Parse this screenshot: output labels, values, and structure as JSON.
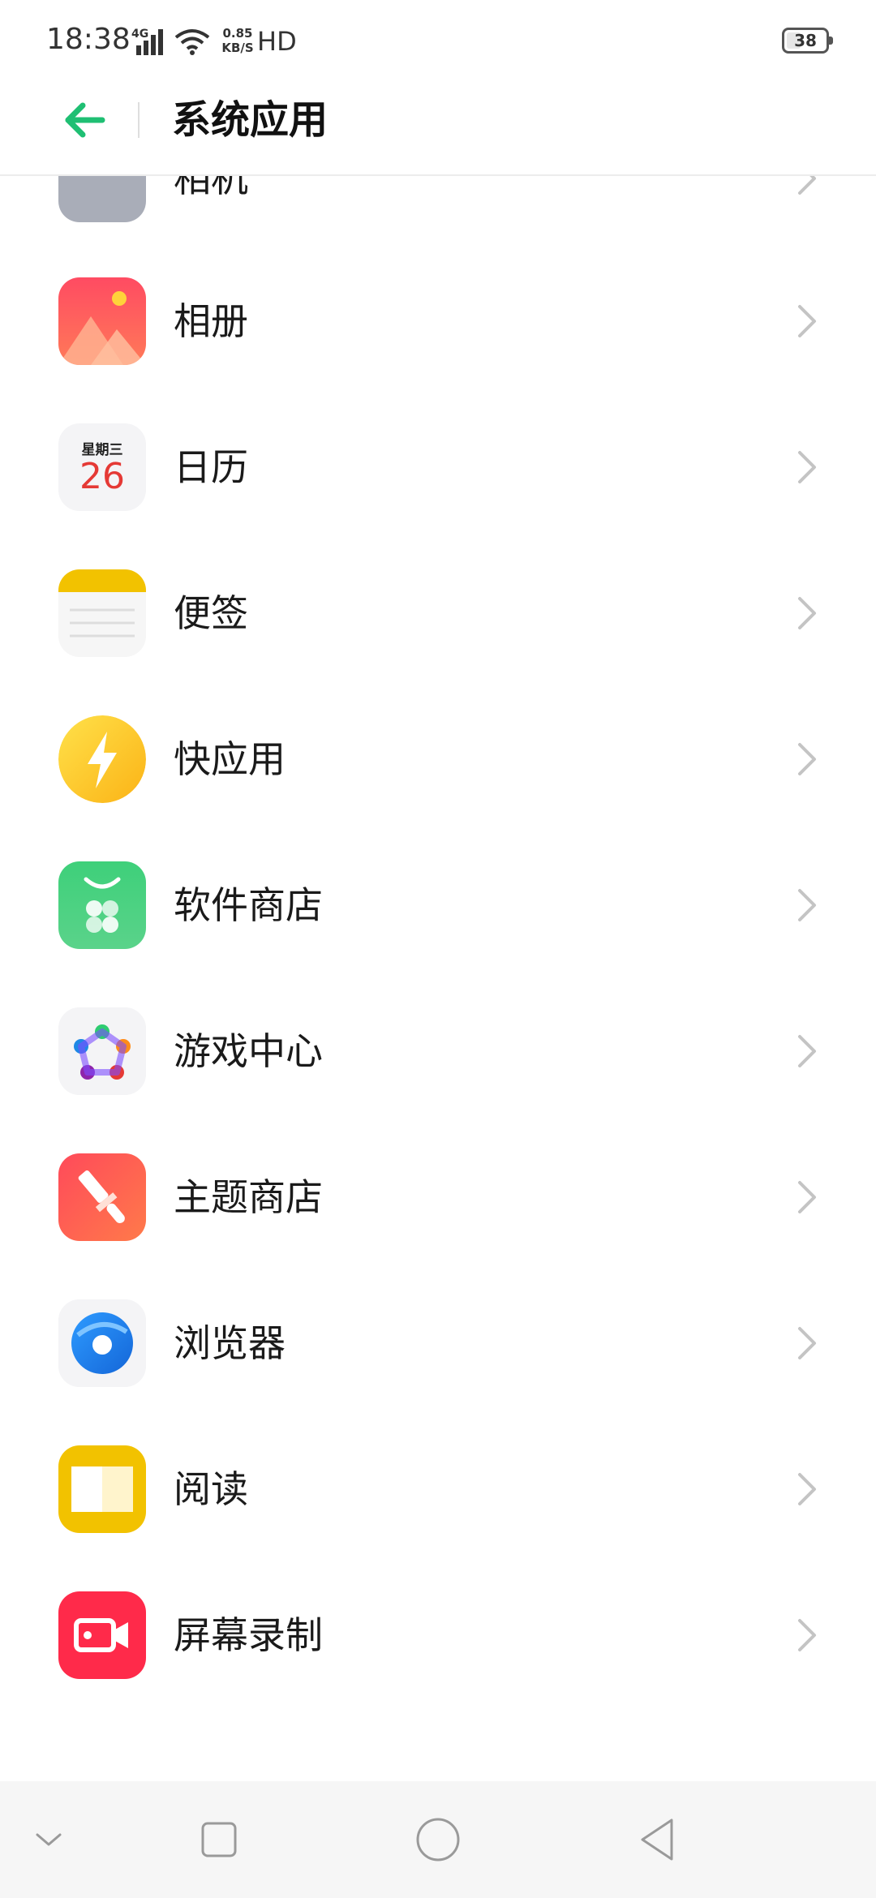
{
  "status": {
    "time": "18:38",
    "net_type": "4G",
    "speed_value": "0.85",
    "speed_unit": "KB/S",
    "hd": "HD",
    "battery": "38",
    "battery_level": 0.38
  },
  "header": {
    "title": "系统应用",
    "back_icon": "arrow-left-icon",
    "accent": "#1fbf73"
  },
  "apps": [
    {
      "label": "相机",
      "icon": "camera-app-icon"
    },
    {
      "label": "相册",
      "icon": "photos-app-icon"
    },
    {
      "label": "日历",
      "icon": "calendar-app-icon",
      "weekday": "星期三",
      "day": "26"
    },
    {
      "label": "便签",
      "icon": "notes-app-icon"
    },
    {
      "label": "快应用",
      "icon": "quick-app-icon"
    },
    {
      "label": "软件商店",
      "icon": "app-store-icon"
    },
    {
      "label": "游戏中心",
      "icon": "game-center-icon"
    },
    {
      "label": "主题商店",
      "icon": "theme-store-icon"
    },
    {
      "label": "浏览器",
      "icon": "browser-app-icon"
    },
    {
      "label": "阅读",
      "icon": "reader-app-icon"
    },
    {
      "label": "屏幕录制",
      "icon": "screen-record-app-icon"
    }
  ],
  "navbar": {
    "buttons": [
      "collapse-icon",
      "recents-icon",
      "home-icon",
      "back-triangle-icon"
    ]
  }
}
